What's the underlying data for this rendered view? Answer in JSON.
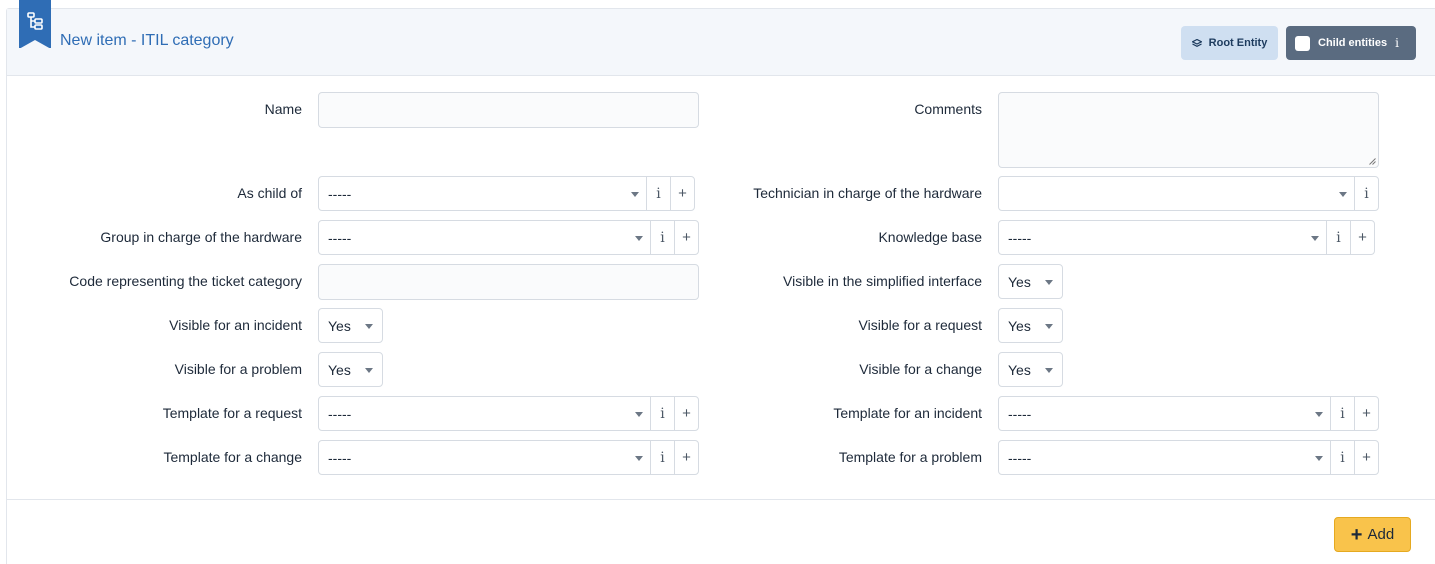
{
  "header": {
    "title": "New item - ITIL category",
    "icon": "tree-structure-icon",
    "root_entity_label": "Root Entity",
    "child_entities_label": "Child entities",
    "info_glyph": "i"
  },
  "form": {
    "name_label": "Name",
    "name_value": "",
    "comments_label": "Comments",
    "comments_value": "",
    "as_child_of_label": "As child of",
    "as_child_of_value": "-----",
    "technician_label": "Technician in charge of the hardware",
    "technician_value": "",
    "group_label": "Group in charge of the hardware",
    "group_value": "-----",
    "knowledge_base_label": "Knowledge base",
    "knowledge_base_value": "-----",
    "code_label": "Code representing the ticket category",
    "code_value": "",
    "visible_simplified_label": "Visible in the simplified interface",
    "visible_simplified_value": "Yes",
    "visible_incident_label": "Visible for an incident",
    "visible_incident_value": "Yes",
    "visible_request_label": "Visible for a request",
    "visible_request_value": "Yes",
    "visible_problem_label": "Visible for a problem",
    "visible_problem_value": "Yes",
    "visible_change_label": "Visible for a change",
    "visible_change_value": "Yes",
    "template_request_label": "Template for a request",
    "template_request_value": "-----",
    "template_incident_label": "Template for an incident",
    "template_incident_value": "-----",
    "template_change_label": "Template for a change",
    "template_change_value": "-----",
    "template_problem_label": "Template for a problem",
    "template_problem_value": "-----",
    "addon_info": "i",
    "addon_add": "+"
  },
  "footer": {
    "add_label": "Add",
    "add_glyph": "+"
  },
  "colors": {
    "accent": "#2f6db5",
    "add_button": "#f9c34b",
    "child_button": "#5a6b80",
    "root_button": "#cfdff1"
  }
}
